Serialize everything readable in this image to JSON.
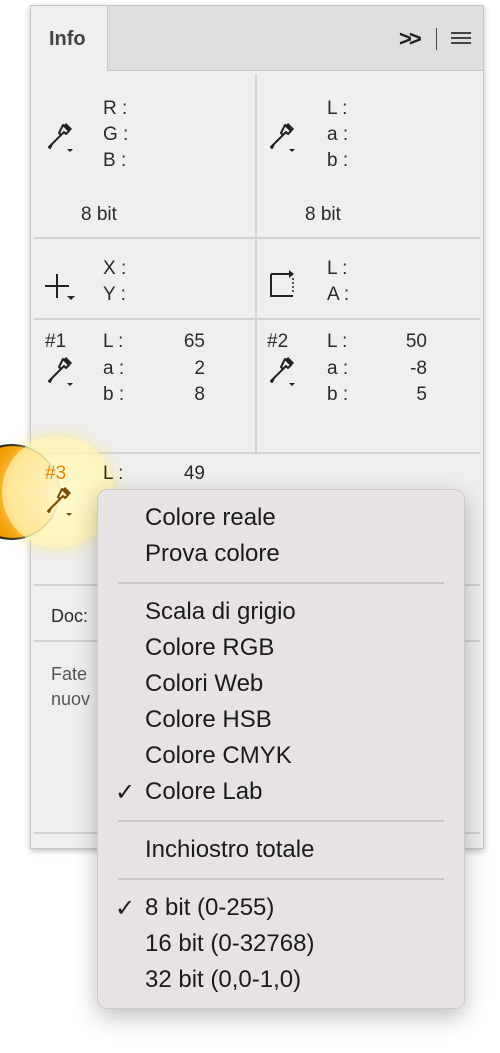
{
  "tab": {
    "title": "Info"
  },
  "readout1": {
    "labels": [
      "R :",
      "G :",
      "B :"
    ],
    "bits": "8 bit"
  },
  "readout2": {
    "labels": [
      "L :",
      "a :",
      "b :"
    ],
    "bits": "8 bit"
  },
  "position": {
    "labels": [
      "X :",
      "Y :"
    ]
  },
  "size": {
    "labels": [
      "L :",
      "A :"
    ]
  },
  "samplers": [
    {
      "id": "#1",
      "labels": [
        "L :",
        "a :",
        "b :"
      ],
      "values": [
        "65",
        "2",
        "8"
      ]
    },
    {
      "id": "#2",
      "labels": [
        "L :",
        "a :",
        "b :"
      ],
      "values": [
        "50",
        "-8",
        "5"
      ]
    },
    {
      "id": "#3",
      "labels": [
        "L :"
      ],
      "values": [
        "49"
      ],
      "color": "#e08a00"
    }
  ],
  "doc": {
    "label": "Doc:"
  },
  "hint": {
    "text": "Fate nuov"
  },
  "context_menu": {
    "groups": [
      [
        {
          "label": "Colore reale"
        },
        {
          "label": "Prova colore"
        }
      ],
      [
        {
          "label": "Scala di grigio"
        },
        {
          "label": "Colore RGB"
        },
        {
          "label": "Colori Web"
        },
        {
          "label": "Colore HSB"
        },
        {
          "label": "Colore CMYK"
        },
        {
          "label": "Colore Lab",
          "checked": true
        }
      ],
      [
        {
          "label": "Inchiostro totale"
        }
      ],
      [
        {
          "label": "8 bit (0-255)",
          "checked": true
        },
        {
          "label": "16 bit (0-32768)"
        },
        {
          "label": "32 bit (0,0-1,0)"
        }
      ]
    ],
    "check_glyph": "✓"
  },
  "colors": {
    "accent": "#f39a00",
    "highlight": "#fff6c4",
    "panel": "#efefef",
    "menu": "#e7e2e4"
  }
}
